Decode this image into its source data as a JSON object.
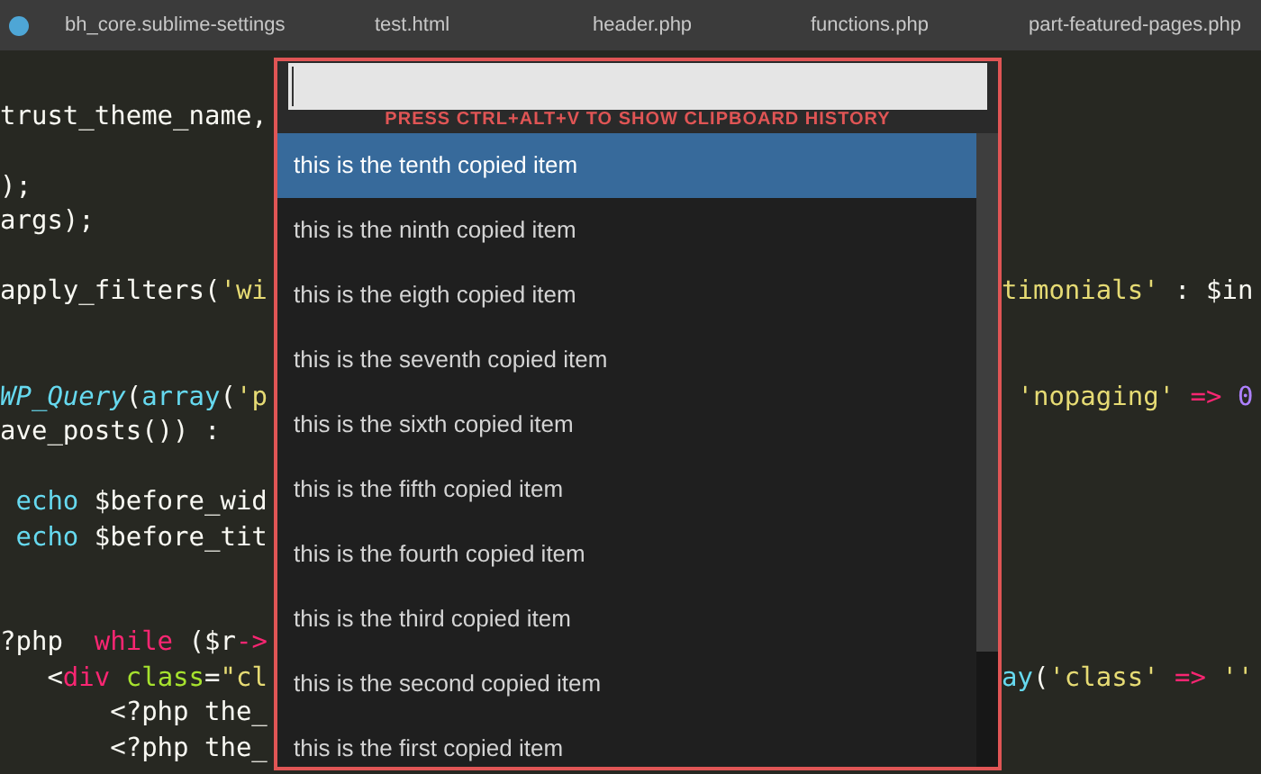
{
  "tabs": [
    {
      "label": "bh_core.sublime-settings",
      "modified": true
    },
    {
      "label": "test.html",
      "modified": false
    },
    {
      "label": "header.php",
      "modified": false
    },
    {
      "label": "functions.php",
      "modified": false
    },
    {
      "label": "part-featured-pages.php",
      "modified": false
    }
  ],
  "code_blocks": [
    [
      {
        "left": [
          {
            "text": "trust_theme_name,",
            "kind": "plain"
          }
        ]
      }
    ],
    [
      {
        "left": [
          {
            "text": ");",
            "kind": "plain"
          }
        ]
      },
      {
        "left": [
          {
            "text": "args);",
            "kind": "plain"
          }
        ]
      }
    ],
    [
      {
        "left": [
          {
            "text": "apply_filters(",
            "kind": "plain"
          },
          {
            "text": "'wi",
            "kind": "string"
          }
        ],
        "right": [
          {
            "text": "timonials'",
            "kind": "string"
          },
          {
            "text": " : $in",
            "kind": "plain"
          }
        ]
      }
    ],
    [
      {
        "left": [
          {
            "text": "WP_Query",
            "kind": "type"
          },
          {
            "text": "(",
            "kind": "plain"
          },
          {
            "text": "array",
            "kind": "function"
          },
          {
            "text": "(",
            "kind": "plain"
          },
          {
            "text": "'p",
            "kind": "string"
          }
        ],
        "right": [
          {
            "text": " 'nopaging'",
            "kind": "string"
          },
          {
            "text": " => ",
            "kind": "keyword"
          },
          {
            "text": "0",
            "kind": "number"
          }
        ]
      },
      {
        "left": [
          {
            "text": "ave_posts()) :",
            "kind": "plain"
          }
        ]
      }
    ],
    [
      {
        "left": [
          {
            "text": " echo",
            "kind": "function"
          },
          {
            "text": " $before_wid",
            "kind": "plain"
          }
        ]
      },
      {
        "left": [
          {
            "text": " echo",
            "kind": "function"
          },
          {
            "text": " $before_tit",
            "kind": "plain"
          }
        ]
      }
    ],
    [
      {
        "left": [
          {
            "text": "?php  ",
            "kind": "plain"
          },
          {
            "text": "while",
            "kind": "keyword"
          },
          {
            "text": " ($r",
            "kind": "plain"
          },
          {
            "text": "->",
            "kind": "keyword"
          }
        ]
      },
      {
        "left": [
          {
            "text": "   <",
            "kind": "plain"
          },
          {
            "text": "div",
            "kind": "keyword"
          },
          {
            "text": " class",
            "kind": "attribute"
          },
          {
            "text": "=",
            "kind": "plain"
          },
          {
            "text": "\"cl",
            "kind": "string"
          }
        ],
        "right": [
          {
            "text": "ay",
            "kind": "function"
          },
          {
            "text": "(",
            "kind": "plain"
          },
          {
            "text": "'class'",
            "kind": "string"
          },
          {
            "text": " => ",
            "kind": "keyword"
          },
          {
            "text": "''",
            "kind": "string"
          }
        ]
      },
      {
        "left": [
          {
            "text": "       <?php the_",
            "kind": "plain"
          }
        ]
      },
      {
        "left": [
          {
            "text": "       <?php the_",
            "kind": "plain"
          }
        ]
      }
    ]
  ],
  "clipboard": {
    "hint": "PRESS CTRL+ALT+V TO SHOW CLIPBOARD HISTORY",
    "items": [
      {
        "label": "this is the tenth copied item",
        "selected": true
      },
      {
        "label": "this is the ninth copied item",
        "selected": false
      },
      {
        "label": "this is the eigth copied item",
        "selected": false
      },
      {
        "label": "this is the seventh copied item",
        "selected": false
      },
      {
        "label": "this is the sixth copied item",
        "selected": false
      },
      {
        "label": "this is the fifth copied item",
        "selected": false
      },
      {
        "label": "this is the fourth copied item",
        "selected": false
      },
      {
        "label": "this is the third copied item",
        "selected": false
      },
      {
        "label": "this is the second copied item",
        "selected": false
      },
      {
        "label": "this is the first copied item",
        "selected": false
      }
    ]
  }
}
